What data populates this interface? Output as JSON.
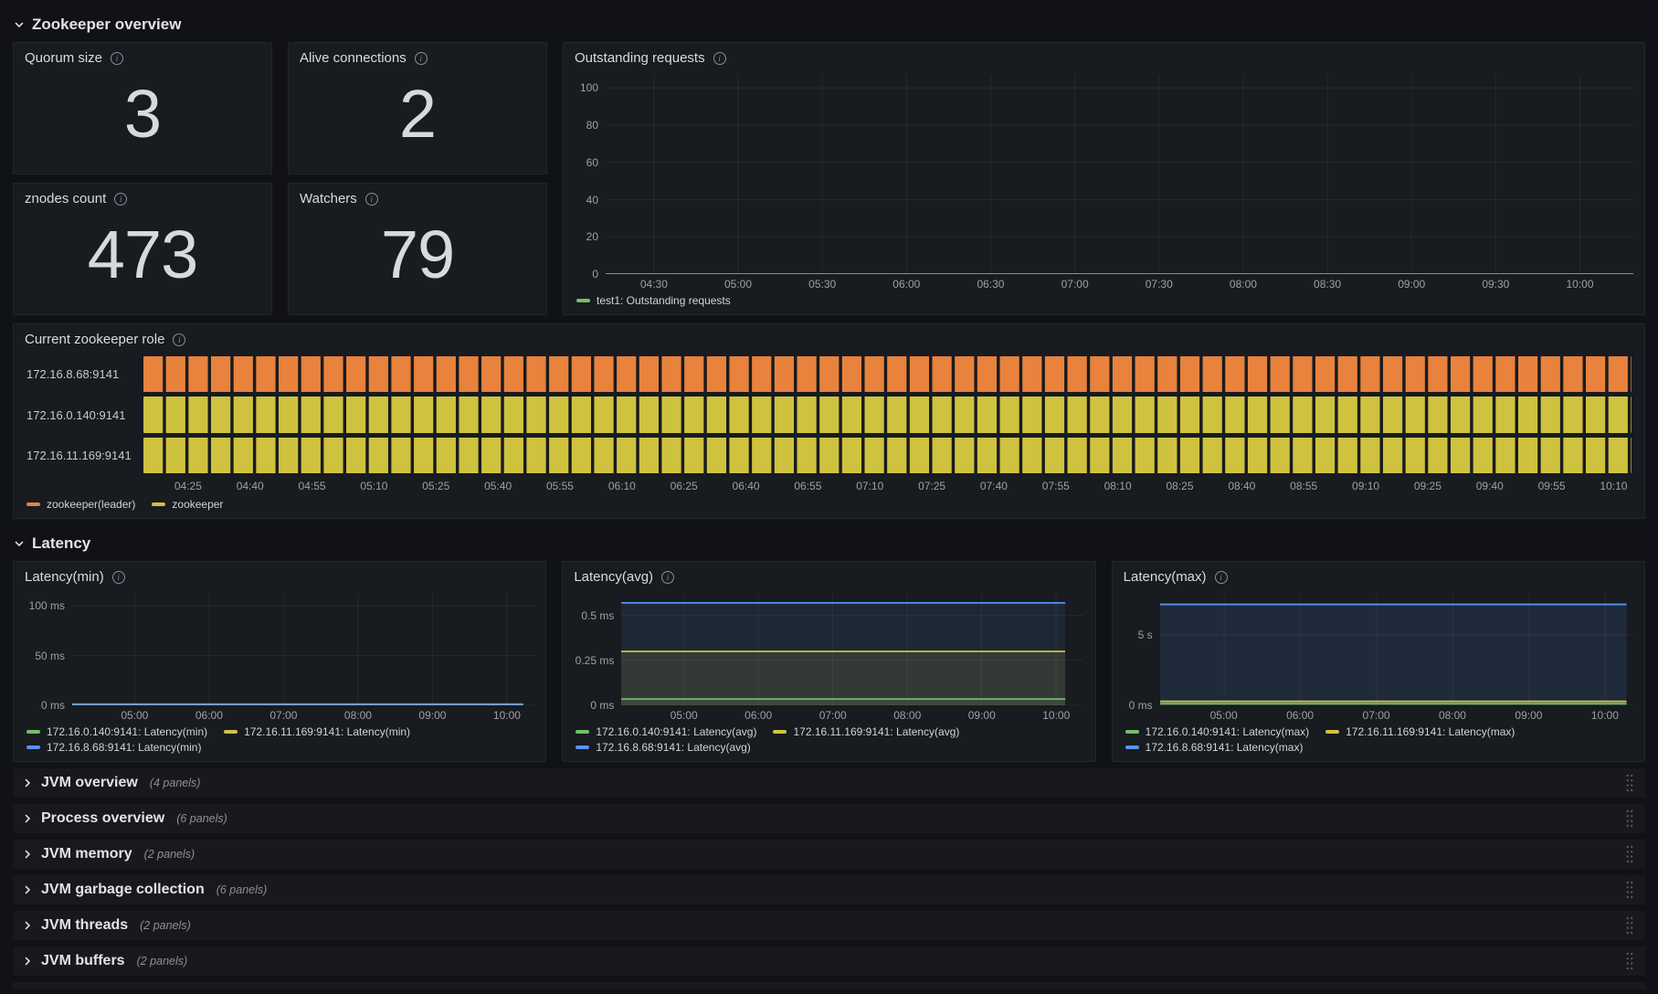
{
  "icons": {
    "info_icon": "i"
  },
  "page": {
    "sections": [
      {
        "title": "Zookeeper overview"
      },
      {
        "title": "Latency"
      }
    ]
  },
  "stats": [
    {
      "title": "Quorum size",
      "value": "3"
    },
    {
      "title": "Alive connections",
      "value": "2"
    },
    {
      "title": "znodes count",
      "value": "473"
    },
    {
      "title": "Watchers",
      "value": "79"
    }
  ],
  "chart_data": [
    {
      "id": "outstanding_requests",
      "type": "line",
      "title": "Outstanding requests",
      "ylim": [
        0,
        107
      ],
      "yticks": [
        {
          "v": 0,
          "label": "0"
        },
        {
          "v": 20,
          "label": "20"
        },
        {
          "v": 40,
          "label": "40"
        },
        {
          "v": 60,
          "label": "60"
        },
        {
          "v": 80,
          "label": "80"
        },
        {
          "v": 100,
          "label": "100"
        }
      ],
      "xticks": [
        "04:30",
        "05:00",
        "05:30",
        "06:00",
        "06:30",
        "07:00",
        "07:30",
        "08:00",
        "08:30",
        "09:00",
        "09:30",
        "10:00"
      ],
      "xtick_range": [
        0.047,
        0.948
      ],
      "yaxis_width": 40,
      "xspan": [
        0,
        1
      ],
      "grid": true,
      "series": [
        {
          "name": "test1: Outstanding requests",
          "color": "#73BF69",
          "value": 0,
          "fill": 0
        }
      ],
      "legend": [
        {
          "label": "test1: Outstanding requests",
          "color": "#73BF69"
        }
      ]
    },
    {
      "id": "current_role",
      "type": "state-timeline",
      "title": "Current zookeeper role",
      "rows": [
        {
          "label": "172.16.8.68:9141",
          "state": "zookeeper(leader)",
          "color": "#E8823C"
        },
        {
          "label": "172.16.0.140:9141",
          "state": "zookeeper",
          "color": "#CFC23F"
        },
        {
          "label": "172.16.11.169:9141",
          "state": "zookeeper",
          "color": "#CFC23F"
        }
      ],
      "segments": 66,
      "xticks": [
        "04:25",
        "04:40",
        "04:55",
        "05:10",
        "05:25",
        "05:40",
        "05:55",
        "06:10",
        "06:25",
        "06:40",
        "06:55",
        "07:10",
        "07:25",
        "07:40",
        "07:55",
        "08:10",
        "08:25",
        "08:40",
        "08:55",
        "09:10",
        "09:25",
        "09:40",
        "09:55",
        "10:10"
      ],
      "xtick_range": [
        0.03,
        0.988
      ],
      "legend": [
        {
          "label": "zookeeper(leader)",
          "color": "#E8823C"
        },
        {
          "label": "zookeeper",
          "color": "#CFC23F"
        }
      ]
    },
    {
      "id": "latency_min",
      "type": "line",
      "title": "Latency(min)",
      "ylim": [
        0,
        112
      ],
      "yticks": [
        {
          "v": 0,
          "label": "0 ms"
        },
        {
          "v": 50,
          "label": "50 ms"
        },
        {
          "v": 100,
          "label": "100 ms"
        }
      ],
      "xticks": [
        "05:00",
        "06:00",
        "07:00",
        "08:00",
        "09:00",
        "10:00"
      ],
      "xtick_range": [
        0.135,
        0.94
      ],
      "yaxis_width": 58,
      "xspan": [
        0,
        0.975
      ],
      "grid": true,
      "series": [
        {
          "name": "172.16.0.140:9141: Latency(min)",
          "color": "#73BF69",
          "value": 0.5,
          "fill": 0
        },
        {
          "name": "172.16.11.169:9141: Latency(min)",
          "color": "#D0C33F",
          "value": 0.8,
          "fill": 0
        },
        {
          "name": "172.16.8.68:9141: Latency(min)",
          "color": "#5794F2",
          "value": 1.2,
          "fill": 0
        }
      ],
      "legend": [
        {
          "label": "172.16.0.140:9141: Latency(min)",
          "color": "#73BF69"
        },
        {
          "label": "172.16.11.169:9141: Latency(min)",
          "color": "#D0C33F"
        },
        {
          "label": "172.16.8.68:9141: Latency(min)",
          "color": "#5794F2"
        }
      ]
    },
    {
      "id": "latency_avg",
      "type": "line",
      "title": "Latency(avg)",
      "ylim": [
        0,
        0.62
      ],
      "yticks": [
        {
          "v": 0,
          "label": "0 ms"
        },
        {
          "v": 0.25,
          "label": "0.25 ms"
        },
        {
          "v": 0.5,
          "label": "0.5 ms"
        }
      ],
      "xticks": [
        "05:00",
        "06:00",
        "07:00",
        "08:00",
        "09:00",
        "10:00"
      ],
      "xtick_range": [
        0.135,
        0.94
      ],
      "yaxis_width": 58,
      "xspan": [
        0,
        0.96
      ],
      "grid": true,
      "series": [
        {
          "name": "172.16.8.68:9141: Latency(avg)",
          "color": "#5794F2",
          "value": 0.57,
          "fill": 0.1
        },
        {
          "name": "172.16.11.169:9141: Latency(avg)",
          "color": "#D0C33F",
          "value": 0.3,
          "fill": 0.12
        },
        {
          "name": "172.16.0.140:9141: Latency(avg)",
          "color": "#73BF69",
          "value": 0.035,
          "fill": 0.12
        }
      ],
      "legend": [
        {
          "label": "172.16.0.140:9141: Latency(avg)",
          "color": "#73BF69"
        },
        {
          "label": "172.16.11.169:9141: Latency(avg)",
          "color": "#D0C33F"
        },
        {
          "label": "172.16.8.68:9141: Latency(avg)",
          "color": "#5794F2"
        }
      ]
    },
    {
      "id": "latency_max",
      "type": "line",
      "title": "Latency(max)",
      "ylim": [
        0,
        7.9
      ],
      "yticks": [
        {
          "v": 0,
          "label": "0 ms"
        },
        {
          "v": 5,
          "label": "5 s"
        }
      ],
      "xticks": [
        "05:00",
        "06:00",
        "07:00",
        "08:00",
        "09:00",
        "10:00"
      ],
      "xtick_range": [
        0.135,
        0.94
      ],
      "yaxis_width": 46,
      "xspan": [
        0,
        0.985
      ],
      "grid": true,
      "series": [
        {
          "name": "172.16.8.68:9141: Latency(max)",
          "color": "#5794F2",
          "value": 7.15,
          "fill": 0.13
        },
        {
          "name": "172.16.11.169:9141: Latency(max)",
          "color": "#D0C33F",
          "value": 0.28,
          "fill": 0.1
        },
        {
          "name": "172.16.0.140:9141: Latency(max)",
          "color": "#73BF69",
          "value": 0.12,
          "fill": 0.1
        }
      ],
      "legend": [
        {
          "label": "172.16.0.140:9141: Latency(max)",
          "color": "#73BF69"
        },
        {
          "label": "172.16.11.169:9141: Latency(max)",
          "color": "#D0C33F"
        },
        {
          "label": "172.16.8.68:9141: Latency(max)",
          "color": "#5794F2"
        }
      ]
    }
  ],
  "rows": [
    {
      "title": "JVM overview",
      "count": "(4 panels)"
    },
    {
      "title": "Process overview",
      "count": "(6 panels)"
    },
    {
      "title": "JVM memory",
      "count": "(2 panels)"
    },
    {
      "title": "JVM garbage collection",
      "count": "(6 panels)"
    },
    {
      "title": "JVM threads",
      "count": "(2 panels)"
    },
    {
      "title": "JVM buffers",
      "count": "(2 panels)"
    }
  ],
  "colors": {
    "background": "#111217",
    "panel": "#181B1F",
    "green": "#73BF69",
    "yellow": "#D0C33F",
    "blue": "#5794F2",
    "orange": "#E8823C",
    "grid": "rgba(204,204,220,0.08)"
  }
}
